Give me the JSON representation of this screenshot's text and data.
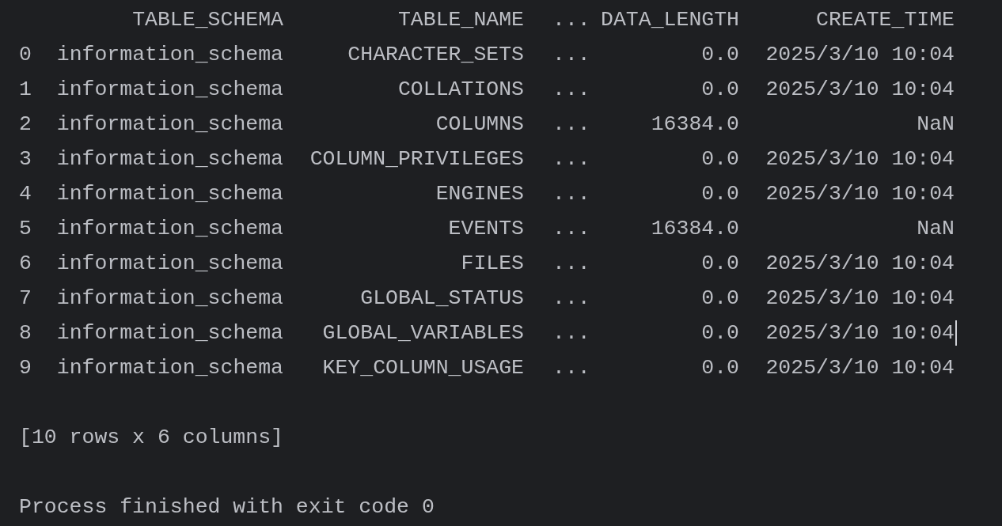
{
  "table": {
    "columns": [
      "",
      "TABLE_SCHEMA",
      "TABLE_NAME",
      "...",
      "DATA_LENGTH",
      "CREATE_TIME"
    ],
    "rows": [
      {
        "cells": [
          "0",
          "information_schema",
          "CHARACTER_SETS",
          "...",
          "0.0",
          "2025/3/10 10:04"
        ],
        "text_cursor": false
      },
      {
        "cells": [
          "1",
          "information_schema",
          "COLLATIONS",
          "...",
          "0.0",
          "2025/3/10 10:04"
        ],
        "text_cursor": false
      },
      {
        "cells": [
          "2",
          "information_schema",
          "COLUMNS",
          "...",
          "16384.0",
          "NaN"
        ],
        "text_cursor": false
      },
      {
        "cells": [
          "3",
          "information_schema",
          "COLUMN_PRIVILEGES",
          "...",
          "0.0",
          "2025/3/10 10:04"
        ],
        "text_cursor": false
      },
      {
        "cells": [
          "4",
          "information_schema",
          "ENGINES",
          "...",
          "0.0",
          "2025/3/10 10:04"
        ],
        "text_cursor": false
      },
      {
        "cells": [
          "5",
          "information_schema",
          "EVENTS",
          "...",
          "16384.0",
          "NaN"
        ],
        "text_cursor": false
      },
      {
        "cells": [
          "6",
          "information_schema",
          "FILES",
          "...",
          "0.0",
          "2025/3/10 10:04"
        ],
        "text_cursor": false
      },
      {
        "cells": [
          "7",
          "information_schema",
          "GLOBAL_STATUS",
          "...",
          "0.0",
          "2025/3/10 10:04"
        ],
        "text_cursor": false
      },
      {
        "cells": [
          "8",
          "information_schema",
          "GLOBAL_VARIABLES",
          "...",
          "0.0",
          "2025/3/10 10:04"
        ],
        "text_cursor": true
      },
      {
        "cells": [
          "9",
          "information_schema",
          "KEY_COLUMN_USAGE",
          "...",
          "0.0",
          "2025/3/10 10:04"
        ],
        "text_cursor": false
      }
    ]
  },
  "summary": "[10 rows x 6 columns]",
  "exit_message": "Process finished with exit code 0"
}
